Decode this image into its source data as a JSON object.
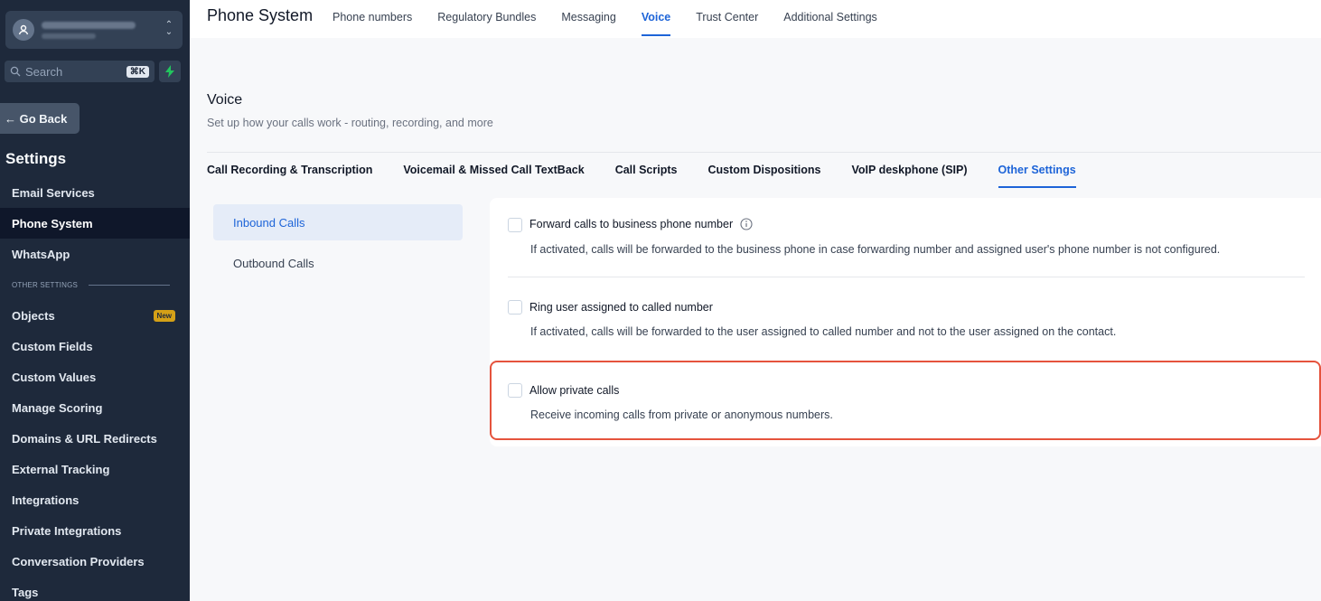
{
  "sidebar": {
    "search_placeholder": "Search",
    "search_shortcut": "⌘K",
    "go_back": "← Go Back",
    "settings_title": "Settings",
    "items_top": [
      {
        "label": "Email Services"
      },
      {
        "label": "Phone System",
        "active": true
      },
      {
        "label": "WhatsApp"
      }
    ],
    "section_label": "OTHER SETTINGS",
    "items_other": [
      {
        "label": "Objects",
        "badge": "New"
      },
      {
        "label": "Custom Fields"
      },
      {
        "label": "Custom Values"
      },
      {
        "label": "Manage Scoring"
      },
      {
        "label": "Domains & URL Redirects"
      },
      {
        "label": "External Tracking"
      },
      {
        "label": "Integrations"
      },
      {
        "label": "Private Integrations"
      },
      {
        "label": "Conversation Providers"
      },
      {
        "label": "Tags"
      }
    ],
    "icons": [
      "account-icon",
      "chevron-updown-icon",
      "search-icon",
      "bolt-icon"
    ]
  },
  "header": {
    "title": "Phone System",
    "tabs": [
      {
        "label": "Phone numbers"
      },
      {
        "label": "Regulatory Bundles"
      },
      {
        "label": "Messaging"
      },
      {
        "label": "Voice",
        "active": true
      },
      {
        "label": "Trust Center"
      },
      {
        "label": "Additional Settings"
      }
    ]
  },
  "voice": {
    "title": "Voice",
    "subtitle": "Set up how your calls work - routing, recording, and more",
    "tabs": [
      {
        "label": "Call Recording & Transcription"
      },
      {
        "label": "Voicemail & Missed Call TextBack"
      },
      {
        "label": "Call Scripts"
      },
      {
        "label": "Custom Dispositions"
      },
      {
        "label": "VoIP deskphone (SIP)"
      },
      {
        "label": "Other Settings",
        "active": true
      }
    ]
  },
  "subnav": [
    {
      "label": "Inbound Calls",
      "active": true
    },
    {
      "label": "Outbound Calls"
    }
  ],
  "options": [
    {
      "label": "Forward calls to business phone number",
      "desc": "If activated, calls will be forwarded to the business phone in case forwarding number and assigned user's phone number is not configured.",
      "checked": false
    },
    {
      "label": "Ring user assigned to called number",
      "desc": "If activated, calls will be forwarded to the user assigned to called number and not to the user assigned on the contact.",
      "checked": false
    },
    {
      "label": "Allow private calls",
      "desc": "Receive incoming calls from private or anonymous numbers.",
      "checked": false
    }
  ],
  "colors": {
    "accent": "#1d64d8",
    "sidebar_bg": "#1e293b",
    "highlight": "#e5533d",
    "badge": "#d4a017"
  }
}
